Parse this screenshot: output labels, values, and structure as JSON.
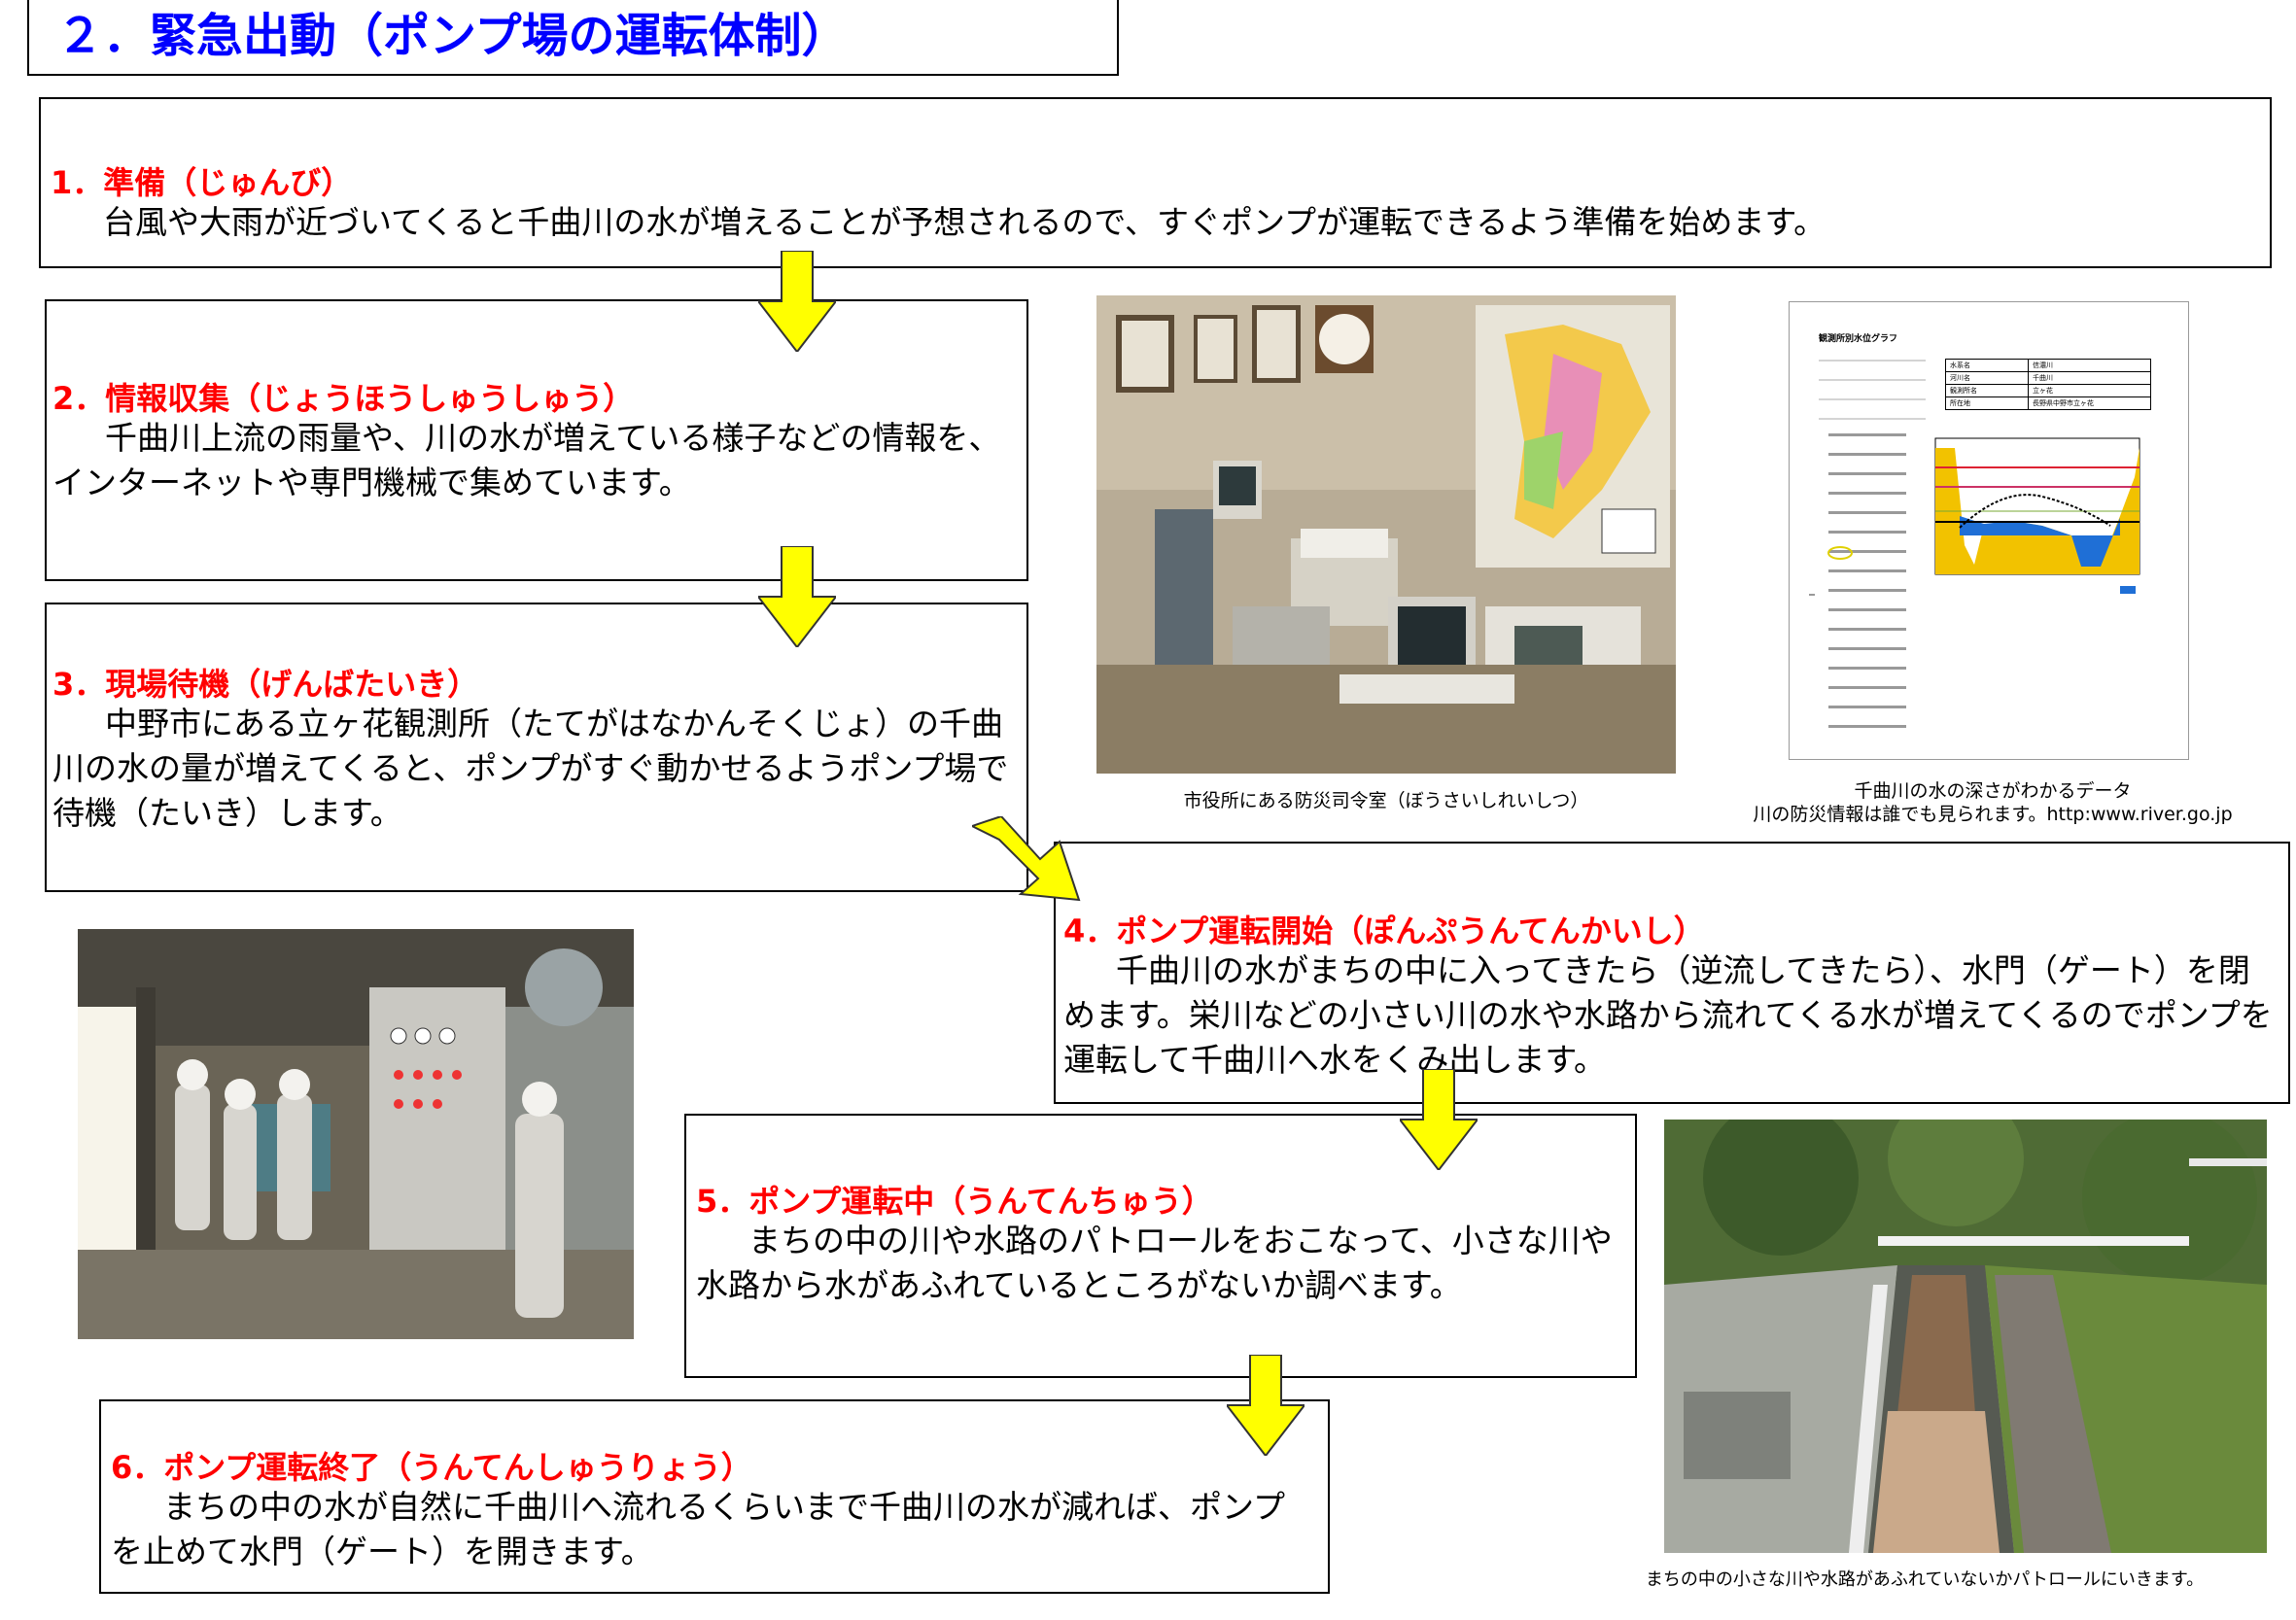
{
  "header": {
    "title": "２．緊急出動（ポンプ場の運転体制）"
  },
  "steps": [
    {
      "title": "1．準備（じゅんび）",
      "body": "台風や大雨が近づいてくると千曲川の水が増えることが予想されるので、すぐポンプが運転できるよう準備を始めます。"
    },
    {
      "title": "2．情報収集（じょうほうしゅうしゅう）",
      "body": "千曲川上流の雨量や、川の水が増えている様子などの情報を、インターネットや専門機械で集めています。"
    },
    {
      "title": "3．現場待機（げんばたいき）",
      "body": "中野市にある立ヶ花観測所（たてがはなかんそくじょ）の千曲川の水の量が増えてくると、ポンプがすぐ動かせるようポンプ場で待機（たいき）します。"
    },
    {
      "title": "4．ポンプ運転開始（ぽんぷうんてんかいし）",
      "body": "千曲川の水がまちの中に入ってきたら（逆流してきたら）、水門（ゲート）を閉めます。栄川などの小さい川の水や水路から流れてくる水が増えてくるのでポンプを運転して千曲川へ水をくみ出します。"
    },
    {
      "title": "5．ポンプ運転中（うんてんちゅう）",
      "body": "まちの中の川や水路のパトロールをおこなって、小さな川や水路から水があふれているところがないか調べます。"
    },
    {
      "title": "6．ポンプ運転終了（うんてんしゅうりょう）",
      "body": "まちの中の水が自然に千曲川へ流れるくらいまで千曲川の水が減れば、ポンプを止めて水門（ゲート）を開きます。"
    }
  ],
  "captions": {
    "control_room": "市役所にある防災司令室（ぼうさいしれいしつ）",
    "graph_line1": "千曲川の水の深さがわかるデータ",
    "graph_line2": "川の防災情報は誰でも見られます。http:www.river.go.jp",
    "patrol": "まちの中の小さな川や水路があふれていないかパトロールにいきます。"
  },
  "graph_doc": {
    "title": "観測所別水位グラフ",
    "table": [
      [
        "水系名",
        "信濃川"
      ],
      [
        "河川名",
        "千曲川"
      ],
      [
        "観測所名",
        "立ヶ花"
      ],
      [
        "所在地",
        "長野県中野市立ヶ花"
      ]
    ]
  },
  "colors": {
    "title_blue": "#0000ff",
    "step_red": "#ff0000",
    "arrow_yellow": "#ffff00",
    "water_blue": "#1f6fd6",
    "bank_yellow": "#f2c200"
  }
}
